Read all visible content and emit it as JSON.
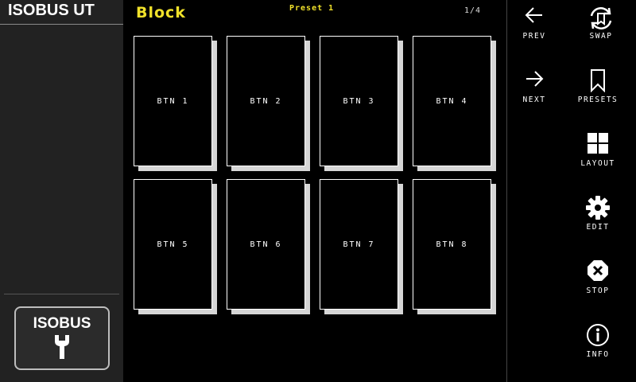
{
  "app": {
    "title": "ISOBUS UT"
  },
  "logo": {
    "text": "ISOBUS"
  },
  "header": {
    "title": "Block",
    "preset": "Preset 1",
    "page": "1/4"
  },
  "grid": {
    "buttons": [
      {
        "label": "BTN 1"
      },
      {
        "label": "BTN 2"
      },
      {
        "label": "BTN 3"
      },
      {
        "label": "BTN 4"
      },
      {
        "label": "BTN 5"
      },
      {
        "label": "BTN 6"
      },
      {
        "label": "BTN 7"
      },
      {
        "label": "BTN 8"
      }
    ]
  },
  "side": {
    "prev": "PREV",
    "swap": "SWAP",
    "next": "NEXT",
    "presets": "PRESETS",
    "layout": "LAYOUT",
    "edit": "EDIT",
    "stop": "STOP",
    "info": "INFO"
  },
  "colors": {
    "accent": "#f0e12a",
    "background": "#000000",
    "panel": "#222222"
  }
}
